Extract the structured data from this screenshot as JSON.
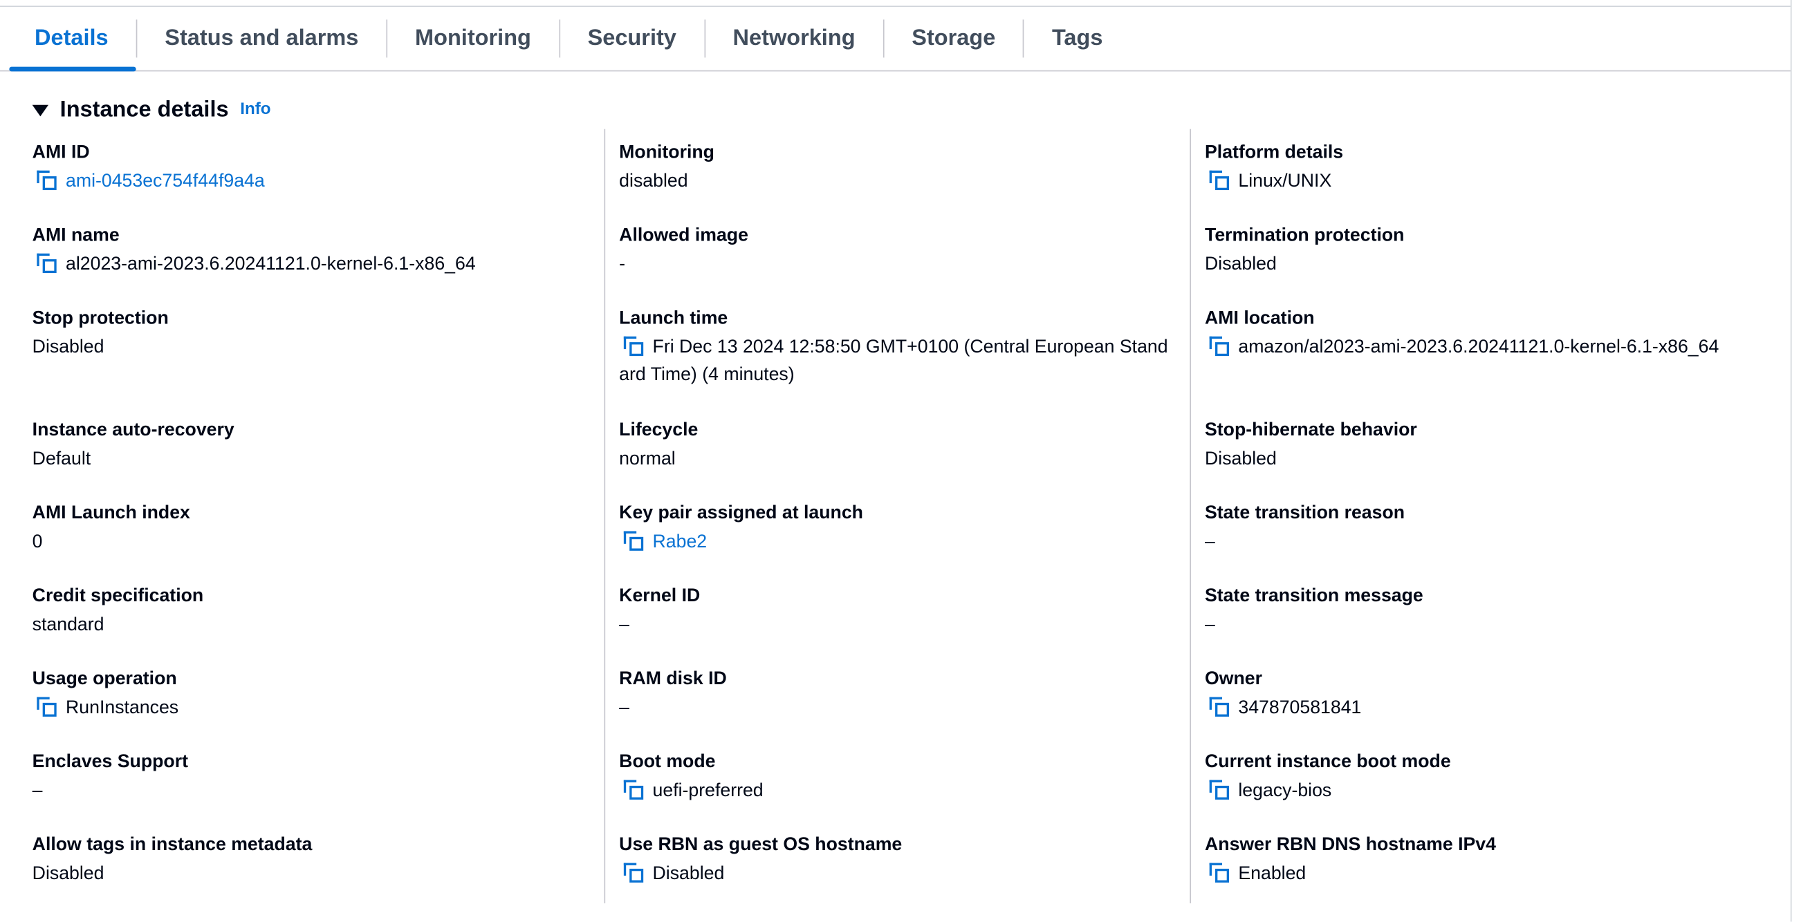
{
  "tabs": [
    {
      "label": "Details",
      "active": true
    },
    {
      "label": "Status and alarms",
      "active": false
    },
    {
      "label": "Monitoring",
      "active": false
    },
    {
      "label": "Security",
      "active": false
    },
    {
      "label": "Networking",
      "active": false
    },
    {
      "label": "Storage",
      "active": false
    },
    {
      "label": "Tags",
      "active": false
    }
  ],
  "section": {
    "title": "Instance details",
    "info_label": "Info"
  },
  "columns": [
    [
      {
        "label": "AMI ID",
        "value": "ami-0453ec754f44f9a4a",
        "copy": true,
        "link": true
      },
      {
        "label": "AMI name",
        "value": "al2023-ami-2023.6.20241121.0-kernel-6.1-x86_64",
        "copy": true,
        "link": false
      },
      {
        "label": "Stop protection",
        "value": "Disabled",
        "copy": false,
        "link": false
      },
      {
        "label": "Instance auto-recovery",
        "value": "Default",
        "copy": false,
        "link": false
      },
      {
        "label": "AMI Launch index",
        "value": "0",
        "copy": false,
        "link": false
      },
      {
        "label": "Credit specification",
        "value": "standard",
        "copy": false,
        "link": false
      },
      {
        "label": "Usage operation",
        "value": "RunInstances",
        "copy": true,
        "link": false
      },
      {
        "label": "Enclaves Support",
        "value": "–",
        "copy": false,
        "link": false
      },
      {
        "label": "Allow tags in instance metadata",
        "value": "Disabled",
        "copy": false,
        "link": false
      }
    ],
    [
      {
        "label": "Monitoring",
        "value": "disabled",
        "copy": false,
        "link": false
      },
      {
        "label": "Allowed image",
        "value": "-",
        "copy": false,
        "link": false
      },
      {
        "label": "Launch time",
        "value": "Fri Dec 13 2024 12:58:50 GMT+0100 (Central European Standard Time) (4 minutes)",
        "copy": true,
        "link": false
      },
      {
        "label": "Lifecycle",
        "value": "normal",
        "copy": false,
        "link": false
      },
      {
        "label": "Key pair assigned at launch",
        "value": "Rabe2",
        "copy": true,
        "link": true
      },
      {
        "label": "Kernel ID",
        "value": "–",
        "copy": false,
        "link": false
      },
      {
        "label": "RAM disk ID",
        "value": "–",
        "copy": false,
        "link": false
      },
      {
        "label": "Boot mode",
        "value": "uefi-preferred",
        "copy": true,
        "link": false
      },
      {
        "label": "Use RBN as guest OS hostname",
        "value": "Disabled",
        "copy": true,
        "link": false
      }
    ],
    [
      {
        "label": "Platform details",
        "value": "Linux/UNIX",
        "copy": true,
        "link": false
      },
      {
        "label": "Termination protection",
        "value": "Disabled",
        "copy": false,
        "link": false
      },
      {
        "label": "AMI location",
        "value": "amazon/al2023-ami-2023.6.20241121.0-kernel-6.1-x86_64",
        "copy": true,
        "link": false
      },
      {
        "label": "Stop-hibernate behavior",
        "value": "Disabled",
        "copy": false,
        "link": false
      },
      {
        "label": "State transition reason",
        "value": "–",
        "copy": false,
        "link": false
      },
      {
        "label": "State transition message",
        "value": "–",
        "copy": false,
        "link": false
      },
      {
        "label": "Owner",
        "value": "347870581841",
        "copy": true,
        "link": false
      },
      {
        "label": "Current instance boot mode",
        "value": "legacy-bios",
        "copy": true,
        "link": false
      },
      {
        "label": "Answer RBN DNS hostname IPv4",
        "value": "Enabled",
        "copy": true,
        "link": false
      }
    ]
  ]
}
